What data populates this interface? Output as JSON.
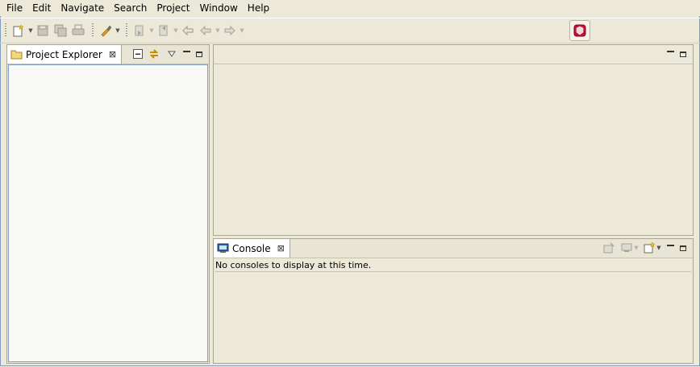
{
  "menubar": {
    "items": [
      "File",
      "Edit",
      "Navigate",
      "Search",
      "Project",
      "Window",
      "Help"
    ]
  },
  "toolbar": {
    "icons": [
      "new-icon",
      "save-icon",
      "save-all-icon",
      "print-icon",
      "brush-icon",
      "next-annotation-icon",
      "previous-annotation-icon",
      "last-edit-icon",
      "back-icon",
      "forward-icon"
    ],
    "perspective_icon": "java-ee-perspective-icon"
  },
  "project_explorer": {
    "tab_label": "Project Explorer",
    "tab_close": "⊠"
  },
  "console": {
    "tab_label": "Console",
    "tab_close": "⊠",
    "message": "No consoles to display at this time."
  },
  "colors": {
    "background": "#ece9d8",
    "panel_border": "#a9a692",
    "explorer_border": "#7f9db9",
    "perspective_red": "#c8102e"
  }
}
